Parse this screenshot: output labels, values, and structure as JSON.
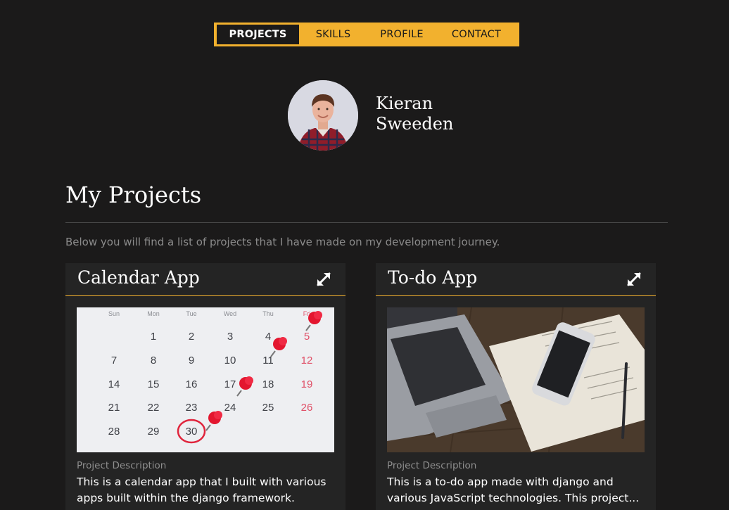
{
  "nav": {
    "items": [
      {
        "label": "PROJECTS",
        "active": true
      },
      {
        "label": "SKILLS",
        "active": false
      },
      {
        "label": "PROFILE",
        "active": false
      },
      {
        "label": "CONTACT",
        "active": false
      }
    ]
  },
  "profile": {
    "first_name": "Kieran",
    "last_name": "Sweeden"
  },
  "main": {
    "title": "My Projects",
    "intro": "Below you will find a list of projects that I have made on my development journey."
  },
  "projects": [
    {
      "title": "Calendar App",
      "description_label": "Project Description",
      "description": "This is a calendar app that I built with various apps built within the django framework."
    },
    {
      "title": "To-do App",
      "description_label": "Project Description",
      "description": "This is a to-do app made with django and various JavaScript technologies. This project..."
    }
  ],
  "calendar_image": {
    "weekdays": [
      "Sun",
      "Mon",
      "Tue",
      "Wed",
      "Thu",
      "Fri"
    ],
    "days": [
      "1",
      "2",
      "3",
      "4",
      "5",
      "7",
      "8",
      "9",
      "10",
      "11",
      "12",
      "14",
      "15",
      "16",
      "17",
      "18",
      "19",
      "21",
      "22",
      "23",
      "24",
      "25",
      "26",
      "28",
      "29",
      "30"
    ]
  },
  "colors": {
    "accent": "#f2b12e",
    "background": "#1b1a1a",
    "card": "#242424",
    "muted_text": "#8b8b8b"
  },
  "icons": {
    "expand": "expand-arrows-icon"
  }
}
